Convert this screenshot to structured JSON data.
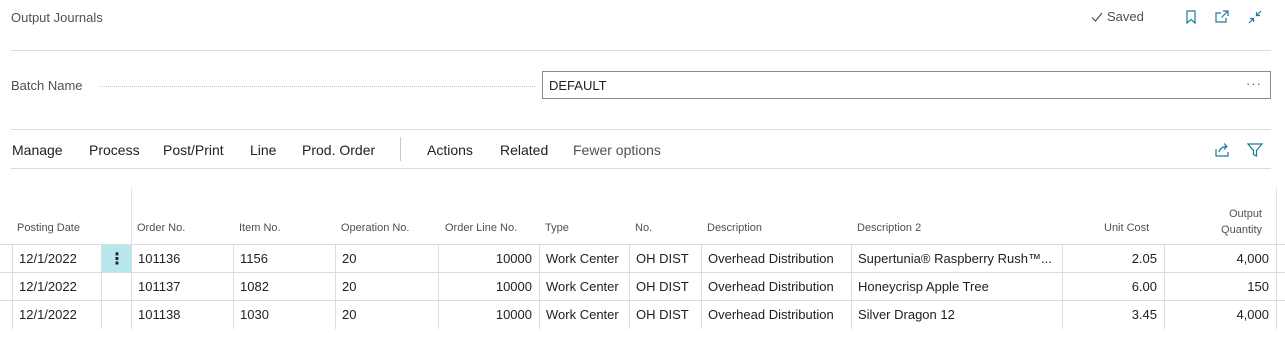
{
  "header": {
    "title": "Output Journals",
    "saved_label": "Saved",
    "icons": [
      "bookmark-icon",
      "open-new-window-icon",
      "collapse-icon"
    ]
  },
  "batch": {
    "label": "Batch Name",
    "value": "DEFAULT",
    "lookup_label": "···"
  },
  "actions": {
    "items": [
      "Manage",
      "Process",
      "Post/Print",
      "Line",
      "Prod. Order",
      "Actions",
      "Related",
      "Fewer options"
    ],
    "icons": [
      "share-icon",
      "filter-icon"
    ]
  },
  "table": {
    "columns": [
      "Posting Date",
      "Order No.",
      "Item No.",
      "Operation No.",
      "Order Line No.",
      "Type",
      "No.",
      "Description",
      "Description 2",
      "Unit Cost",
      "Output",
      "Quantity"
    ],
    "rows": [
      {
        "posting_date": "12/1/2022",
        "order_no": "101136",
        "item_no": "1156",
        "operation_no": "20",
        "order_line_no": "10000",
        "type": "Work Center",
        "no": "OH DIST",
        "description": "Overhead Distribution",
        "description2": "Supertunia® Raspberry Rush™...",
        "unit_cost": "2.05",
        "output_quantity": "4,000"
      },
      {
        "posting_date": "12/1/2022",
        "order_no": "101137",
        "item_no": "1082",
        "operation_no": "20",
        "order_line_no": "10000",
        "type": "Work Center",
        "no": "OH DIST",
        "description": "Overhead Distribution",
        "description2": "Honeycrisp Apple Tree",
        "unit_cost": "6.00",
        "output_quantity": "150"
      },
      {
        "posting_date": "12/1/2022",
        "order_no": "101138",
        "item_no": "1030",
        "operation_no": "20",
        "order_line_no": "10000",
        "type": "Work Center",
        "no": "OH DIST",
        "description": "Overhead Distribution",
        "description2": "Silver Dragon 12",
        "unit_cost": "3.45",
        "output_quantity": "4,000"
      }
    ],
    "row_menu_label": "⋮"
  },
  "colors": {
    "accent": "#1c7b9c",
    "row_selector": "#b7e6ec",
    "text": "#212121",
    "muted": "#505050"
  }
}
